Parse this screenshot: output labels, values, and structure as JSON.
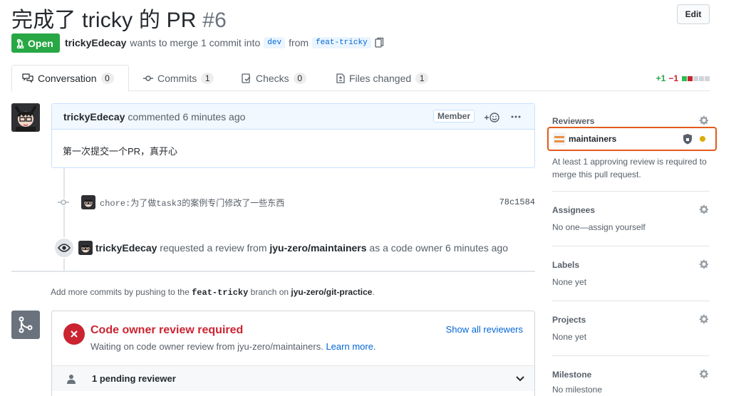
{
  "header": {
    "title_text": "完成了 tricky 的 PR",
    "title_number": "#6",
    "edit_label": "Edit"
  },
  "state": {
    "label": "Open",
    "author": "trickyEdecay",
    "merge_text": "wants to merge 1 commit into",
    "base_branch": "dev",
    "from_text": "from",
    "head_branch": "feat-tricky"
  },
  "tabs": [
    {
      "label": "Conversation",
      "count": "0"
    },
    {
      "label": "Commits",
      "count": "1"
    },
    {
      "label": "Checks",
      "count": "0"
    },
    {
      "label": "Files changed",
      "count": "1"
    }
  ],
  "diffstat": {
    "additions": "+1",
    "deletions": "−1"
  },
  "comment": {
    "author": "trickyEdecay",
    "action": "commented 6 minutes ago",
    "role": "Member",
    "body": "第一次提交一个PR，真开心"
  },
  "commit": {
    "message": "chore:为了做task3的案例专门修改了一些东西",
    "sha": "78c1584"
  },
  "review_event": {
    "author": "trickyEdecay",
    "text1": "requested a review from",
    "team": "jyu-zero/maintainers",
    "text2": "as a code owner 6 minutes ago"
  },
  "hint": {
    "prefix": "Add more commits by pushing to the",
    "branch": "feat-tricky",
    "middle": "branch on",
    "repo": "jyu-zero/git-practice",
    "suffix": "."
  },
  "merge_box": {
    "title": "Code owner review required",
    "subtitle": "Waiting on code owner review from jyu-zero/maintainers.",
    "learn_more": "Learn more.",
    "show_all": "Show all reviewers",
    "pending": "1 pending reviewer"
  },
  "sidebar": {
    "reviewers": {
      "heading": "Reviewers",
      "team": "maintainers",
      "note": "At least 1 approving review is required to merge this pull request."
    },
    "assignees": {
      "heading": "Assignees",
      "value": "No one—assign yourself"
    },
    "labels": {
      "heading": "Labels",
      "value": "None yet"
    },
    "projects": {
      "heading": "Projects",
      "value": "None yet"
    },
    "milestone": {
      "heading": "Milestone",
      "value": "No milestone"
    }
  },
  "colors": {
    "open_green": "#28a745",
    "error_red": "#cb2431",
    "link_blue": "#0366d6",
    "highlight_orange": "#e25a1c",
    "pending_dot": "#dbab09"
  }
}
